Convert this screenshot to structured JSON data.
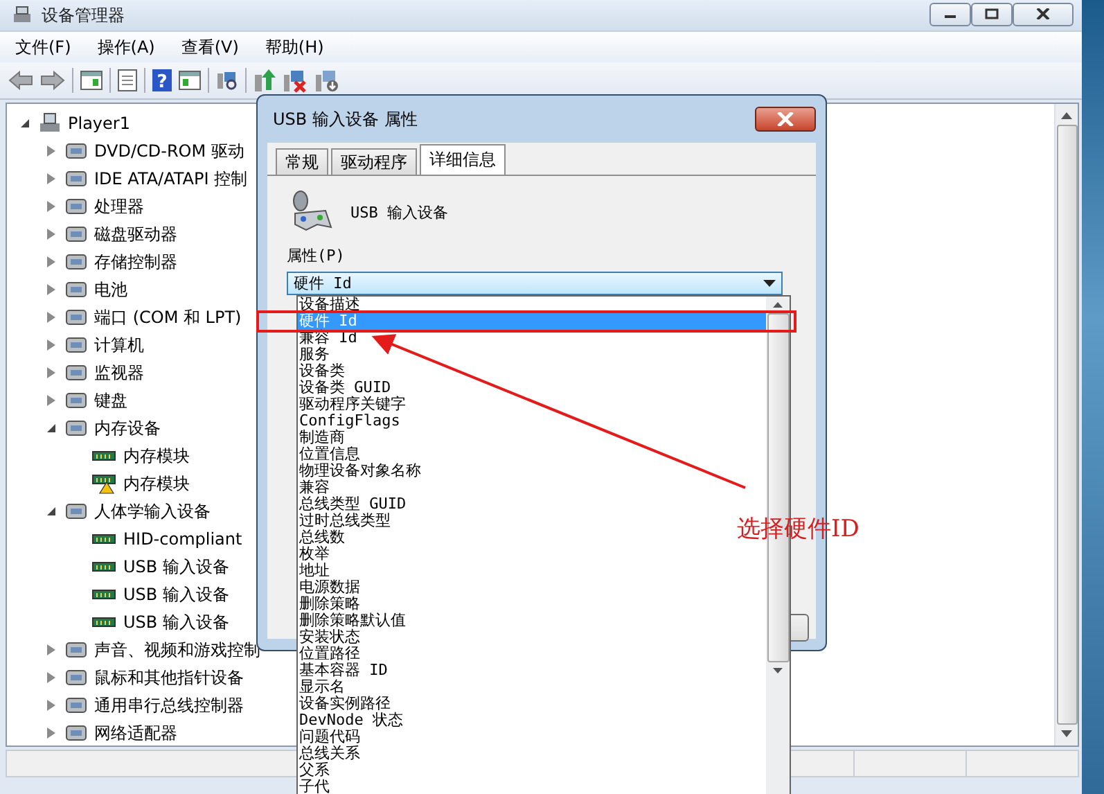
{
  "window": {
    "title": "设备管理器",
    "menu": [
      "文件(F)",
      "操作(A)",
      "查看(V)",
      "帮助(H)"
    ],
    "help_glyph": "?"
  },
  "tree": {
    "root": {
      "label": "Player1",
      "expanded": true,
      "children": [
        {
          "label": "DVD/CD-ROM 驱动",
          "expanded": false
        },
        {
          "label": "IDE ATA/ATAPI 控制",
          "expanded": false
        },
        {
          "label": "处理器",
          "expanded": false
        },
        {
          "label": "磁盘驱动器",
          "expanded": false
        },
        {
          "label": "存储控制器",
          "expanded": false
        },
        {
          "label": "电池",
          "expanded": false
        },
        {
          "label": "端口 (COM 和 LPT)",
          "expanded": false
        },
        {
          "label": "计算机",
          "expanded": false
        },
        {
          "label": "监视器",
          "expanded": false
        },
        {
          "label": "键盘",
          "expanded": false
        },
        {
          "label": "内存设备",
          "expanded": true,
          "children": [
            {
              "label": "内存模块",
              "warning": false
            },
            {
              "label": "内存模块",
              "warning": true
            }
          ]
        },
        {
          "label": "人体学输入设备",
          "expanded": true,
          "children": [
            {
              "label": "HID-compliant",
              "warning": false
            },
            {
              "label": "USB 输入设备",
              "warning": false
            },
            {
              "label": "USB 输入设备",
              "warning": false
            },
            {
              "label": "USB 输入设备",
              "warning": false
            }
          ]
        },
        {
          "label": "声音、视频和游戏控制",
          "expanded": false
        },
        {
          "label": "鼠标和其他指针设备",
          "expanded": false
        },
        {
          "label": "通用串行总线控制器",
          "expanded": false
        },
        {
          "label": "网络适配器",
          "expanded": false
        }
      ]
    }
  },
  "dialog": {
    "title": "USB 输入设备 属性",
    "tabs": [
      {
        "label": "常规",
        "selected": false
      },
      {
        "label": "驱动程序",
        "selected": false
      },
      {
        "label": "详细信息",
        "selected": true
      }
    ],
    "device_name": "USB 输入设备",
    "property_label": "属性(P)",
    "dropdown_value": "硬件 Id",
    "options": [
      {
        "label": "设备描述",
        "selected": false
      },
      {
        "label": "硬件 Id",
        "selected": true
      },
      {
        "label": "兼容 Id",
        "selected": false
      },
      {
        "label": "服务",
        "selected": false
      },
      {
        "label": "设备类",
        "selected": false
      },
      {
        "label": "设备类 GUID",
        "selected": false
      },
      {
        "label": "驱动程序关键字",
        "selected": false
      },
      {
        "label": "ConfigFlags",
        "selected": false
      },
      {
        "label": "制造商",
        "selected": false
      },
      {
        "label": "位置信息",
        "selected": false
      },
      {
        "label": "物理设备对象名称",
        "selected": false
      },
      {
        "label": "兼容",
        "selected": false
      },
      {
        "label": "总线类型 GUID",
        "selected": false
      },
      {
        "label": "过时总线类型",
        "selected": false
      },
      {
        "label": "总线数",
        "selected": false
      },
      {
        "label": "枚举",
        "selected": false
      },
      {
        "label": "地址",
        "selected": false
      },
      {
        "label": "电源数据",
        "selected": false
      },
      {
        "label": "删除策略",
        "selected": false
      },
      {
        "label": "删除策略默认值",
        "selected": false
      },
      {
        "label": "安装状态",
        "selected": false
      },
      {
        "label": "位置路径",
        "selected": false
      },
      {
        "label": "基本容器 ID",
        "selected": false
      },
      {
        "label": "显示名",
        "selected": false
      },
      {
        "label": "设备实例路径",
        "selected": false
      },
      {
        "label": "DevNode 状态",
        "selected": false
      },
      {
        "label": "问题代码",
        "selected": false
      },
      {
        "label": "总线关系",
        "selected": false
      },
      {
        "label": "父系",
        "selected": false
      },
      {
        "label": "子代",
        "selected": false
      }
    ]
  },
  "annotation": {
    "label": "选择硬件ID"
  }
}
